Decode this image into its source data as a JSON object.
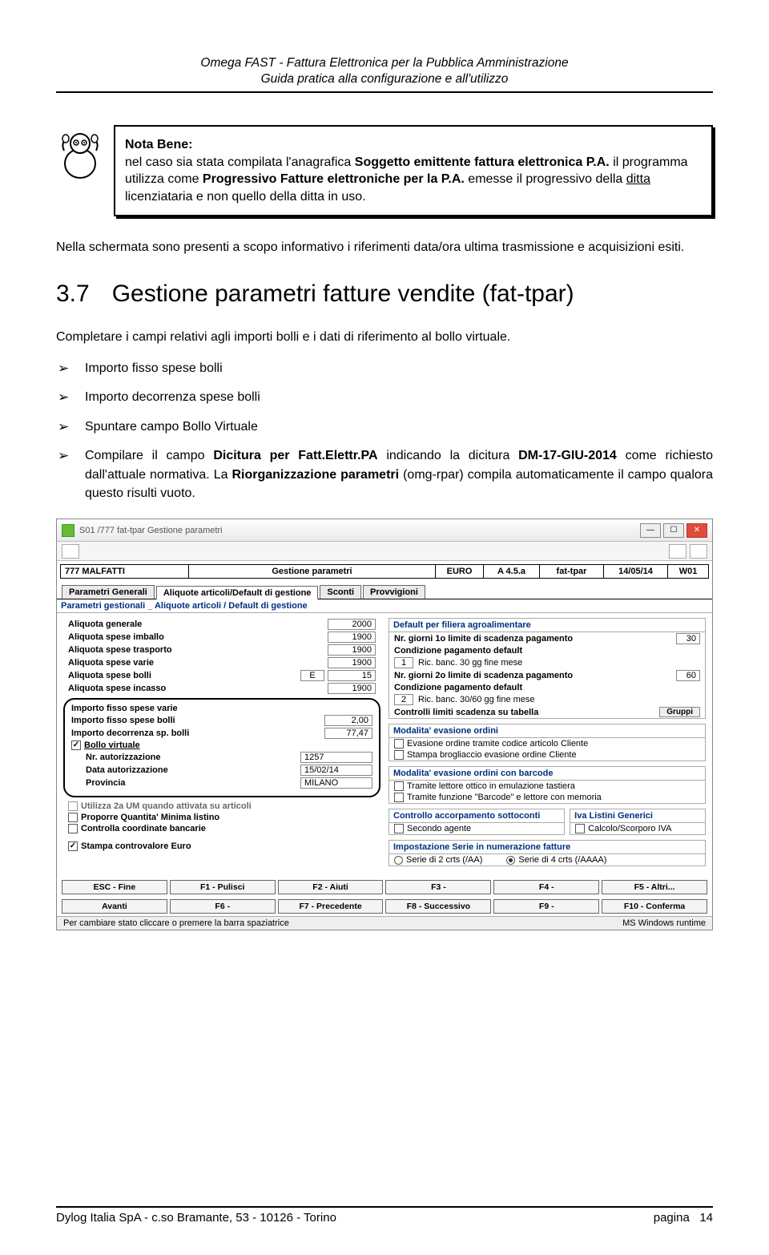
{
  "header": {
    "line1": "Omega FAST - Fattura Elettronica per la Pubblica Amministrazione",
    "line2": "Guida pratica alla configurazione e all'utilizzo"
  },
  "notebox": {
    "title": "Nota Bene:",
    "text_a": "nel caso sia stata compilata l'anagrafica ",
    "bold_a": "Soggetto emittente fattura elettronica P.A.",
    "text_b": " il programma utilizza come ",
    "bold_b": "Progressivo Fatture elettroniche per la P.A.",
    "text_c": " emesse il progressivo della ",
    "underlined": "ditta",
    "text_d": " licenziataria e non quello della ditta in uso."
  },
  "para1": "Nella schermata sono presenti a scopo informativo i riferimenti data/ora ultima trasmissione e acquisizioni esiti.",
  "section": {
    "num": "3.7",
    "title": "Gestione parametri fatture vendite (fat-tpar)"
  },
  "para2": "Completare i campi relativi agli importi bolli e i dati di riferimento al bollo virtuale.",
  "bullets": {
    "b1": "Importo fisso spese bolli",
    "b2": "Importo decorrenza spese bolli",
    "b3": "Spuntare campo Bollo Virtuale",
    "b4_a": "Compilare il campo ",
    "b4_bold1": "Dicitura per Fatt.Elettr.PA",
    "b4_b": " indicando la dicitura ",
    "b4_bold2": "DM-17-GIU-2014",
    "b4_c": " come richiesto dall'attuale normativa. La ",
    "b4_bold3": "Riorganizzazione parametri",
    "b4_d": " (omg-rpar) compila automaticamente il campo qualora questo risulti vuoto."
  },
  "ss": {
    "title": "S01 /777 fat-tpar Gestione parametri",
    "ditta": "777 MALFATTI",
    "center": "Gestione parametri",
    "cur": "EURO",
    "ver": "A 4.5.a",
    "mod": "fat-tpar",
    "date": "14/05/14",
    "ws": "W01",
    "tabs": {
      "t1": "Parametri Generali",
      "t2": "Aliquote articoli/Default di gestione",
      "t3": "Sconti",
      "t4": "Provvigioni"
    },
    "fieldset_legend": "Parametri gestionali _ Aliquote articoli / Default di gestione",
    "al_gen_l": "Aliquota generale",
    "al_gen_v": "2000",
    "al_imb_l": "Aliquota spese imballo",
    "al_imb_v": "1900",
    "al_tra_l": "Aliquota spese trasporto",
    "al_tra_v": "1900",
    "al_var_l": "Aliquota spese varie",
    "al_var_v": "1900",
    "al_bol_l": "Aliquota spese bolli",
    "al_bol_e": "E",
    "al_bol_v": "15",
    "al_inc_l": "Aliquota spese incasso",
    "al_inc_v": "1900",
    "ifsv_l": "Importo fisso spese varie",
    "ifsb_l": "Importo fisso spese bolli",
    "ifsb_v": "2,00",
    "idsb_l": "Importo decorrenza sp. bolli",
    "idsb_v": "77,47",
    "bv_l": "Bollo virtuale",
    "nra_l": "Nr. autorizzazione",
    "nra_v": "1257",
    "dta_l": "Data autorizzazione",
    "dta_v": "15/02/14",
    "prov_l": "Provincia",
    "prov_v": "MILANO",
    "cut_line": "Utilizza 2a UM quando attivata su articoli",
    "pq_l": "Proporre Quantita' Minima listino",
    "ccb_l": "Controlla coordinate bancarie",
    "sce_l": "Stampa controvalore Euro",
    "df_legend": "Default per filiera agroalimentare",
    "ng1_l": "Nr. giorni 1o limite di scadenza pagamento",
    "ng1_v": "30",
    "cp1_l": "Condizione pagamento default",
    "cp1_code": "1",
    "cp1_txt": "Ric. banc. 30 gg fine mese",
    "ng2_l": "Nr. giorni 2o limite di scadenza pagamento",
    "ng2_v": "60",
    "cp2_l": "Condizione pagamento default",
    "cp2_code": "2",
    "cp2_txt": "Ric. banc. 30/60 gg fine mese",
    "clst_l": "Controlli limiti scadenza su tabella",
    "clst_btn": "Gruppi",
    "meo": "Modalita' evasione ordini",
    "meo1": "Evasione ordine tramite codice articolo Cliente",
    "meo2": "Stampa brogliaccio evasione ordine Cliente",
    "meob": "Modalita' evasione ordini con barcode",
    "meob1": "Tramite lettore ottico in emulazione tastiera",
    "meob2": "Tramite funzione \"Barcode\" e lettore con memoria",
    "cap": "Controllo accorpamento sottoconti",
    "cap1": "Secondo agente",
    "ilg": "Iva Listini Generici",
    "ilg1": "Calcolo/Scorporo IVA",
    "isn": "Impostazione Serie in numerazione fatture",
    "isn1": "Serie di 2 crts (/AA)",
    "isn2": "Serie di 4 crts (/AAAA)",
    "fn": {
      "esc": "ESC - Fine",
      "f1": "F1 - Pulisci",
      "f2": "F2 - Aiuti",
      "f3": "F3 -",
      "f4": "F4 -",
      "f5": "F5 - Altri...",
      "av": "Avanti",
      "f6": "F6 -",
      "f7": "F7 - Precedente",
      "f8": "F8 - Successivo",
      "f9": "F9 -",
      "f10": "F10 - Conferma"
    },
    "status_l": "Per cambiare stato cliccare o premere la barra spaziatrice",
    "status_r": "MS Windows runtime"
  },
  "footer": {
    "left": "Dylog Italia SpA - c.so Bramante, 53 - 10126 - Torino",
    "right_lbl": "pagina",
    "right_num": "14"
  }
}
